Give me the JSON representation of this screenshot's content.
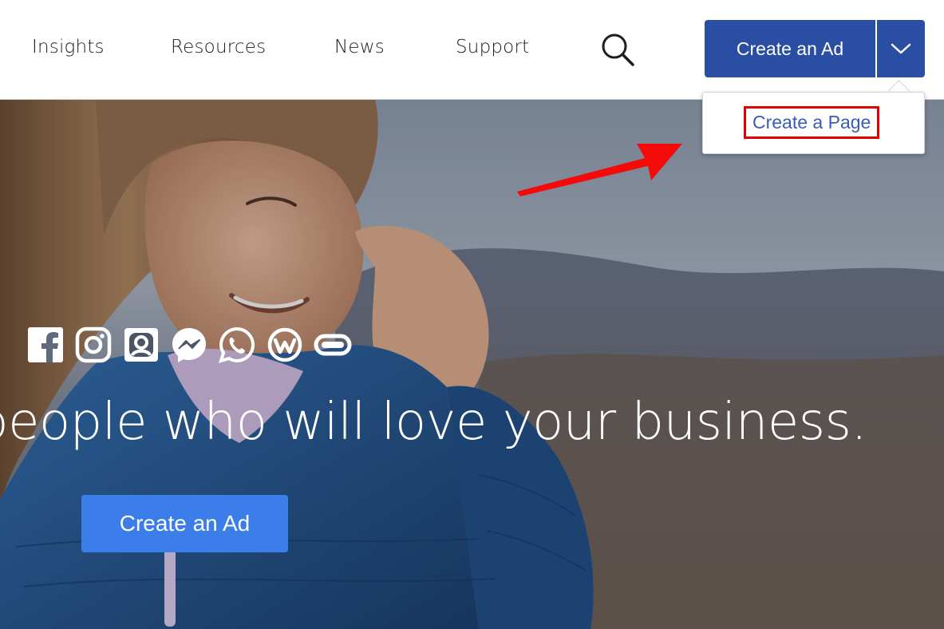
{
  "nav": {
    "items": [
      {
        "label": "Insights"
      },
      {
        "label": "Resources"
      },
      {
        "label": "News"
      },
      {
        "label": "Support"
      }
    ],
    "search_icon": "search-icon",
    "cta_label": "Create an Ad",
    "cta_toggle_icon": "chevron-down-icon"
  },
  "dropdown": {
    "items": [
      {
        "label": "Create a Page"
      }
    ]
  },
  "hero": {
    "brand_icons": [
      "facebook-icon",
      "instagram-icon",
      "portal-icon",
      "messenger-icon",
      "whatsapp-icon",
      "workplace-icon",
      "oculus-icon"
    ],
    "tagline": "people who will love your business.",
    "cta_label": "Create an Ad"
  },
  "colors": {
    "primary_blue": "#2a4ea3",
    "hero_button_blue": "#3b7de9",
    "link_blue": "#3b5bb5",
    "highlight_red": "#e00000"
  }
}
